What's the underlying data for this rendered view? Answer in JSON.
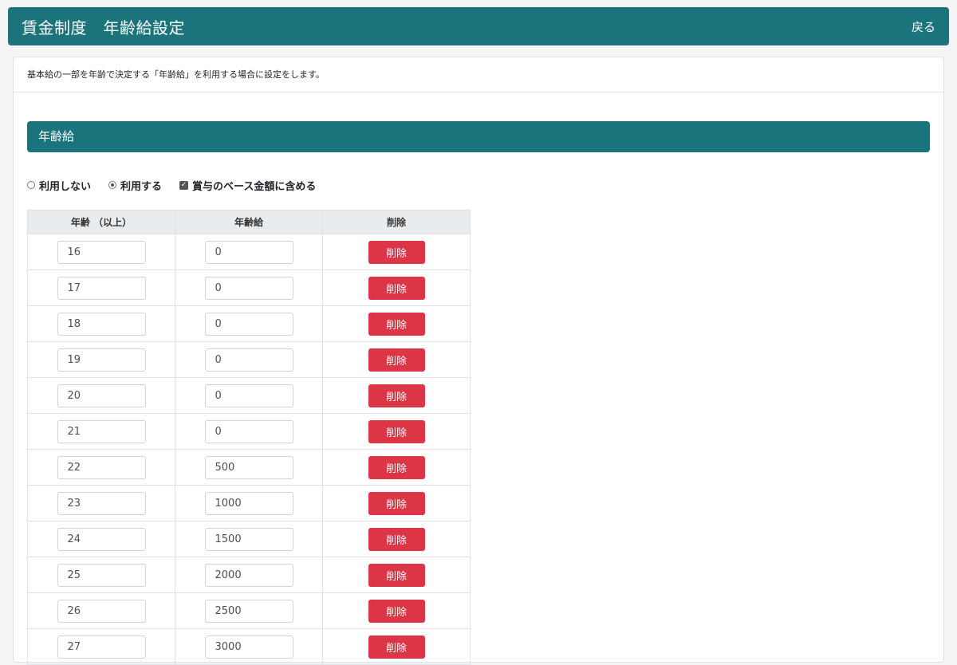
{
  "header": {
    "title": "賃金制度　年齢給設定",
    "back_label": "戻る"
  },
  "description": "基本給の一部を年齢で決定する「年齢給」を利用する場合に設定をします。",
  "section": {
    "title": "年齢給"
  },
  "options": {
    "not_use": {
      "label": "利用しない",
      "selected": false
    },
    "use": {
      "label": "利用する",
      "selected": true
    },
    "include_bonus": {
      "label": "賞与のベース金額に含める",
      "checked": true
    }
  },
  "table": {
    "headers": [
      "年齢 （以上）",
      "年齢給",
      "削除"
    ],
    "delete_label": "削除",
    "rows": [
      {
        "age": "16",
        "amount": "0"
      },
      {
        "age": "17",
        "amount": "0"
      },
      {
        "age": "18",
        "amount": "0"
      },
      {
        "age": "19",
        "amount": "0"
      },
      {
        "age": "20",
        "amount": "0"
      },
      {
        "age": "21",
        "amount": "0"
      },
      {
        "age": "22",
        "amount": "500"
      },
      {
        "age": "23",
        "amount": "1000"
      },
      {
        "age": "24",
        "amount": "1500"
      },
      {
        "age": "25",
        "amount": "2000"
      },
      {
        "age": "26",
        "amount": "2500"
      },
      {
        "age": "27",
        "amount": "3000"
      }
    ]
  }
}
